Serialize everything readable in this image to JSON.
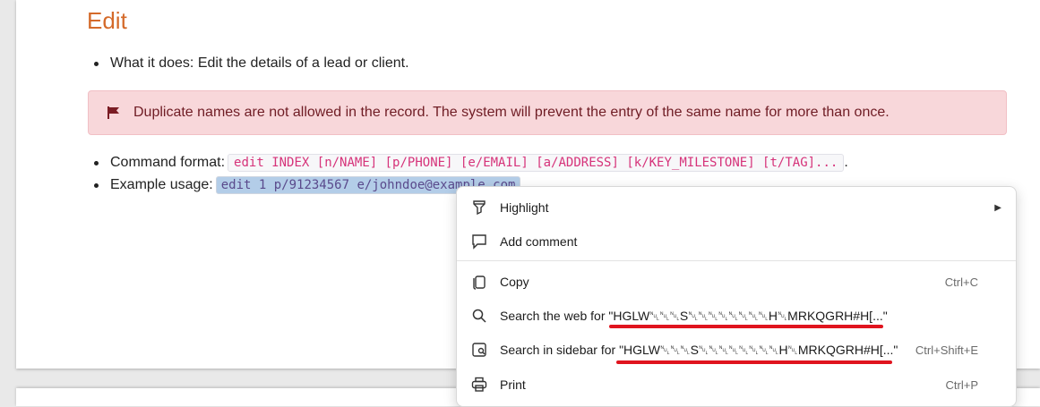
{
  "document": {
    "heading": "Edit",
    "what_it_does": "What it does: Edit the details of a lead or client.",
    "alert_text": "Duplicate names are not allowed in the record. The system will prevent the entry of the same name for more than once.",
    "command_label": "Command format:",
    "command_code": "edit INDEX [n/NAME] [p/PHONE] [e/EMAIL] [a/ADDRESS] [k/KEY_MILESTONE] [t/TAG]...",
    "command_suffix": ".",
    "example_label": "Example usage:",
    "example_code": "edit 1 p/91234567 e/johndoe@example.com"
  },
  "context_menu": {
    "items": [
      {
        "label": "Highlight",
        "icon": "highlighter-icon",
        "has_submenu": true
      },
      {
        "label": "Add comment",
        "icon": "comment-icon"
      },
      {
        "label": "Copy",
        "icon": "copy-icon",
        "shortcut": "Ctrl+C"
      },
      {
        "label": "Search the web for \"HGLW␀␀␀S␀␀␀␀␀␀␀␀H␀MRKQGRH#H[...\"",
        "icon": "search-icon"
      },
      {
        "label": "Search in sidebar for \"HGLW␀␀␀S␀␀␀␀␀␀␀␀H␀MRKQGRH#H[...\"",
        "icon": "sidebar-search-icon",
        "shortcut": "Ctrl+Shift+E"
      },
      {
        "label": "Print",
        "icon": "print-icon",
        "shortcut": "Ctrl+P"
      }
    ]
  },
  "colors": {
    "heading": "#d46a2a",
    "alert_bg": "#f8d7da",
    "alert_text": "#6f1c24",
    "code_text": "#d6337a",
    "annotation": "#e0141e"
  }
}
